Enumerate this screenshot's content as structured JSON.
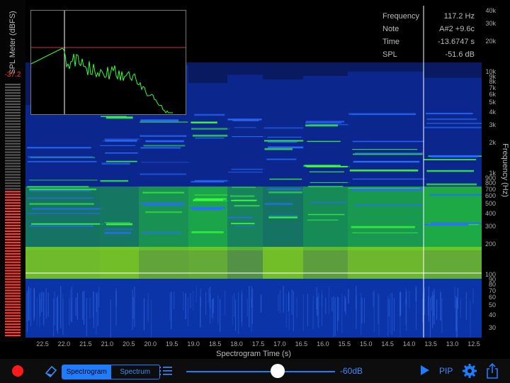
{
  "meter": {
    "title": "SPL Meter (dBFS)",
    "value": "-37.2",
    "level_fraction": 0.58,
    "color_active": "#ff3b30",
    "color_inactive": "#555555"
  },
  "readout": {
    "frequency_label": "Frequency",
    "frequency_value": "117.2 Hz",
    "note_label": "Note",
    "note_value": "A#2 +9.6c",
    "time_label": "Time",
    "time_value": "-13.6747 s",
    "spl_label": "SPL",
    "spl_value": "-51.6 dB"
  },
  "freq_axis": {
    "title": "Frequency (Hz)",
    "ticks": [
      "40k",
      "30k",
      "20k",
      "10k",
      "9k",
      "8k",
      "7k",
      "6k",
      "5k",
      "4k",
      "3k",
      "2k",
      "1k",
      "900",
      "800",
      "700",
      "600",
      "500",
      "400",
      "300",
      "200",
      "100",
      "90",
      "80",
      "70",
      "60",
      "50",
      "40",
      "30"
    ]
  },
  "time_axis": {
    "title": "Spectrogram Time (s)",
    "ticks": [
      "22.5",
      "22.0",
      "21.5",
      "21.0",
      "20.5",
      "20.0",
      "19.5",
      "19.0",
      "18.5",
      "18.0",
      "17.5",
      "17.0",
      "16.5",
      "16.0",
      "15.5",
      "15.0",
      "14.5",
      "14.0",
      "13.5",
      "13.0",
      "12.5"
    ]
  },
  "toolbar": {
    "record_icon": "record-icon",
    "eraser_icon": "eraser-icon",
    "spectrogram_label": "Spectrogram",
    "spectrum_label": "Spectrum",
    "list_icon": "list-icon",
    "level_label": "-60dB",
    "slider_fraction": 0.62,
    "play_icon": "play-icon",
    "pip_label": "PIP",
    "settings_icon": "gear-icon",
    "share_icon": "share-icon"
  },
  "colors": {
    "accent": "#1e7cff",
    "cursor_line": "#ffffff",
    "spectrum_line": "#33ff33",
    "reference_line": "#cc3333"
  }
}
